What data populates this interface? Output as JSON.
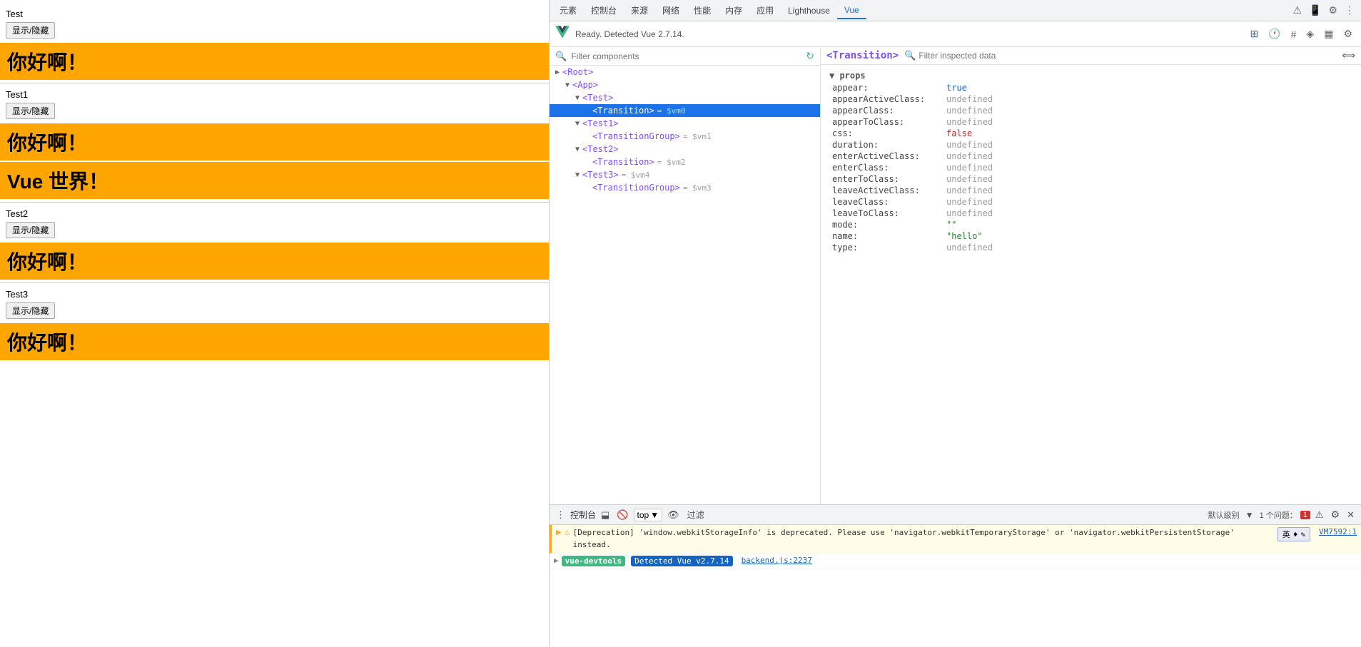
{
  "left": {
    "sections": [
      {
        "id": "test",
        "label": "Test",
        "btn_label": "显示/隐藏",
        "bars": [
          {
            "text": "你好啊！",
            "large": false
          }
        ]
      },
      {
        "id": "test1",
        "label": "Test1",
        "btn_label": "显示/隐藏",
        "bars": [
          {
            "text": "你好啊！",
            "large": false
          },
          {
            "text": "Vue 世界！",
            "large": false
          }
        ]
      },
      {
        "id": "test2",
        "label": "Test2",
        "btn_label": "显示/隐藏",
        "bars": [
          {
            "text": "你好啊！",
            "large": false
          }
        ]
      },
      {
        "id": "test3",
        "label": "Test3",
        "btn_label": "显示/隐藏",
        "bars": [
          {
            "text": "你好啊！",
            "large": false
          }
        ]
      }
    ]
  },
  "devtools": {
    "tabs": [
      "元素",
      "控制台",
      "来源",
      "网络",
      "性能",
      "内存",
      "应用",
      "Lighthouse",
      "Vue"
    ],
    "active_tab": "Vue",
    "vue_status": "Ready. Detected Vue 2.7.14.",
    "filter_placeholder": "Filter components",
    "inspect_placeholder": "Filter inspected data",
    "selected_component": "<Transition>",
    "tree": [
      {
        "id": "root",
        "label": "<Root>",
        "depth": 0,
        "arrow": "▶",
        "vm": ""
      },
      {
        "id": "app",
        "label": "<App>",
        "depth": 1,
        "arrow": "▼",
        "vm": ""
      },
      {
        "id": "test",
        "label": "<Test>",
        "depth": 2,
        "arrow": "▼",
        "vm": ""
      },
      {
        "id": "transition",
        "label": "<Transition>",
        "depth": 3,
        "arrow": "",
        "vm": "= $vm0",
        "selected": true
      },
      {
        "id": "test1",
        "label": "<Test1>",
        "depth": 2,
        "arrow": "▼",
        "vm": ""
      },
      {
        "id": "transitiongroup1",
        "label": "<TransitionGroup>",
        "depth": 3,
        "arrow": "",
        "vm": "= $vm1"
      },
      {
        "id": "test2",
        "label": "<Test2>",
        "depth": 2,
        "arrow": "▼",
        "vm": ""
      },
      {
        "id": "transition2",
        "label": "<Transition>",
        "depth": 3,
        "arrow": "",
        "vm": "= $vm2"
      },
      {
        "id": "test3",
        "label": "<Test3>",
        "depth": 2,
        "arrow": "▼",
        "vm": "= $vm4"
      },
      {
        "id": "transitiongroup3",
        "label": "<TransitionGroup>",
        "depth": 3,
        "arrow": "",
        "vm": "= $vm3"
      }
    ],
    "props": {
      "section": "props",
      "items": [
        {
          "key": "appear:",
          "value": "true",
          "type": "true"
        },
        {
          "key": "appearActiveClass:",
          "value": "undefined",
          "type": "undefined"
        },
        {
          "key": "appearClass:",
          "value": "undefined",
          "type": "undefined"
        },
        {
          "key": "appearToClass:",
          "value": "undefined",
          "type": "undefined"
        },
        {
          "key": "css:",
          "value": "false",
          "type": "false"
        },
        {
          "key": "duration:",
          "value": "undefined",
          "type": "undefined"
        },
        {
          "key": "enterActiveClass:",
          "value": "undefined",
          "type": "undefined"
        },
        {
          "key": "enterClass:",
          "value": "undefined",
          "type": "undefined"
        },
        {
          "key": "enterToClass:",
          "value": "undefined",
          "type": "undefined"
        },
        {
          "key": "leaveActiveClass:",
          "value": "undefined",
          "type": "undefined"
        },
        {
          "key": "leaveClass:",
          "value": "undefined",
          "type": "undefined"
        },
        {
          "key": "leaveToClass:",
          "value": "undefined",
          "type": "undefined"
        },
        {
          "key": "mode:",
          "value": "\"\"",
          "type": "string"
        },
        {
          "key": "name:",
          "value": "\"hello\"",
          "type": "string"
        },
        {
          "key": "type:",
          "value": "undefined",
          "type": "undefined"
        }
      ]
    }
  },
  "console": {
    "title": "控制台",
    "top_label": "top",
    "filter_label": "过滤",
    "issue_count": "1 个问题：",
    "warning_count": "1",
    "default_level": "默认级别",
    "warning_text": "[Deprecation] 'window.webkitStorageInfo' is deprecated. Please use 'navigator.webkitTemporaryStorage' or 'navigator.webkitPersistentStorage' instead.",
    "warning_source": "VM7592:1",
    "vue_devtools_label": "vue-devtools",
    "detected_label": "Detected Vue v2.7.14",
    "detected_source": "backend.js:2237"
  }
}
